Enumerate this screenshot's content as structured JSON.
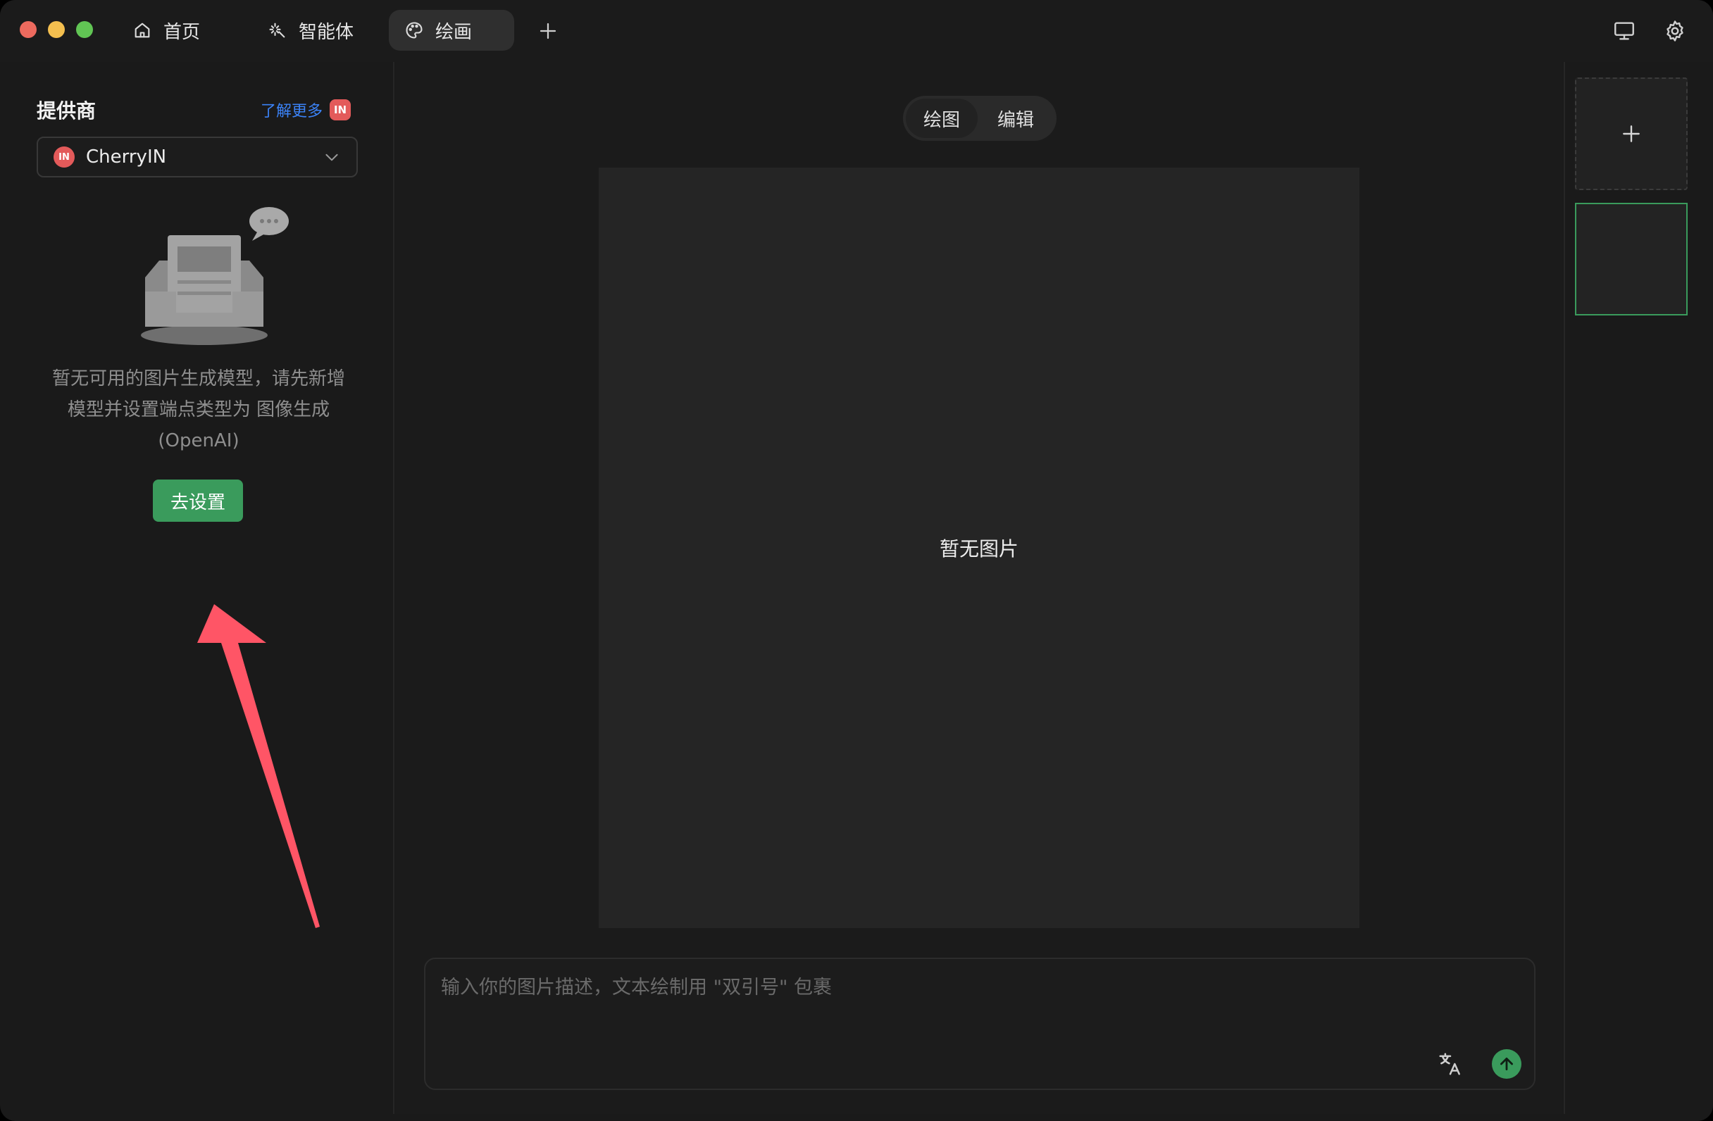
{
  "tabs": [
    {
      "label": "首页",
      "icon": "home-icon",
      "active": false
    },
    {
      "label": "智能体",
      "icon": "sparkle-icon",
      "active": false
    },
    {
      "label": "绘画",
      "icon": "palette-icon",
      "active": true
    }
  ],
  "sidebar": {
    "provider_title": "提供商",
    "learn_more": "了解更多",
    "badge": "IN",
    "provider_select": {
      "value": "CherryIN",
      "logo": "IN"
    },
    "empty_message": "暂无可用的图片生成模型，请先新增模型并设置端点类型为 图像生成 (OpenAI)",
    "go_settings": "去设置"
  },
  "center": {
    "mode_tabs": [
      {
        "label": "绘图",
        "active": true
      },
      {
        "label": "编辑",
        "active": false
      }
    ],
    "canvas_empty": "暂无图片",
    "prompt_placeholder": "输入你的图片描述，文本绘制用 \"双引号\" 包裹"
  },
  "colors": {
    "accent": "#3a9b5c",
    "badge": "#e35a5a",
    "link": "#3b82f6",
    "annotation_arrow": "#ff5566"
  },
  "icons": [
    "home-icon",
    "sparkle-icon",
    "palette-icon",
    "plus-icon",
    "monitor-icon",
    "gear-icon",
    "chevron-down-icon",
    "translate-icon",
    "arrow-up-icon"
  ]
}
